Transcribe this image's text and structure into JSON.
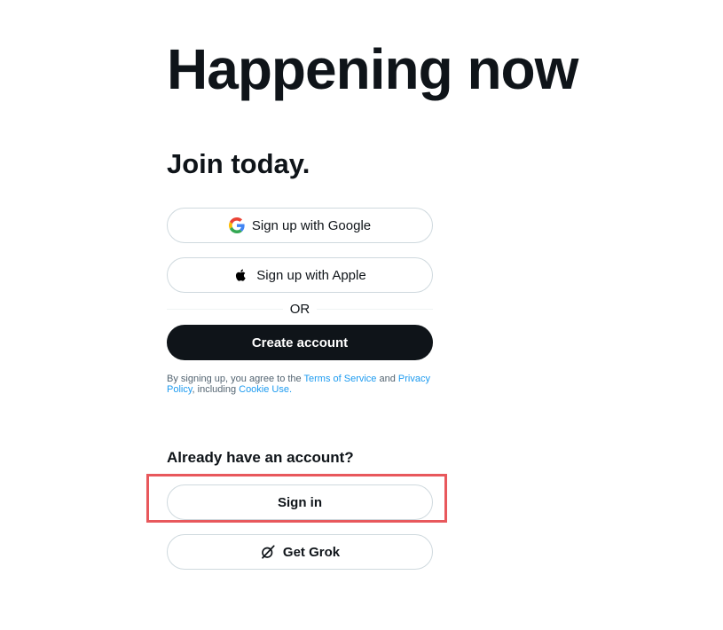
{
  "headline": "Happening now",
  "subhead": "Join today.",
  "buttons": {
    "google": "Sign up with Google",
    "apple": "Sign up with Apple",
    "create": "Create account",
    "signin": "Sign in",
    "grok": "Get Grok"
  },
  "divider_text": "OR",
  "terms": {
    "prefix": "By signing up, you agree to the ",
    "tos": "Terms of Service",
    "and": " and ",
    "privacy": "Privacy Policy",
    "including": ", including ",
    "cookie": "Cookie Use",
    "period": "."
  },
  "already_have_account": "Already have an account?",
  "icons": {
    "google": "google-icon",
    "apple": "apple-icon",
    "grok": "grok-icon"
  },
  "colors": {
    "text": "#0f1419",
    "link": "#1d9bf0",
    "border": "#cfd9de",
    "highlight": "#e8585c"
  }
}
